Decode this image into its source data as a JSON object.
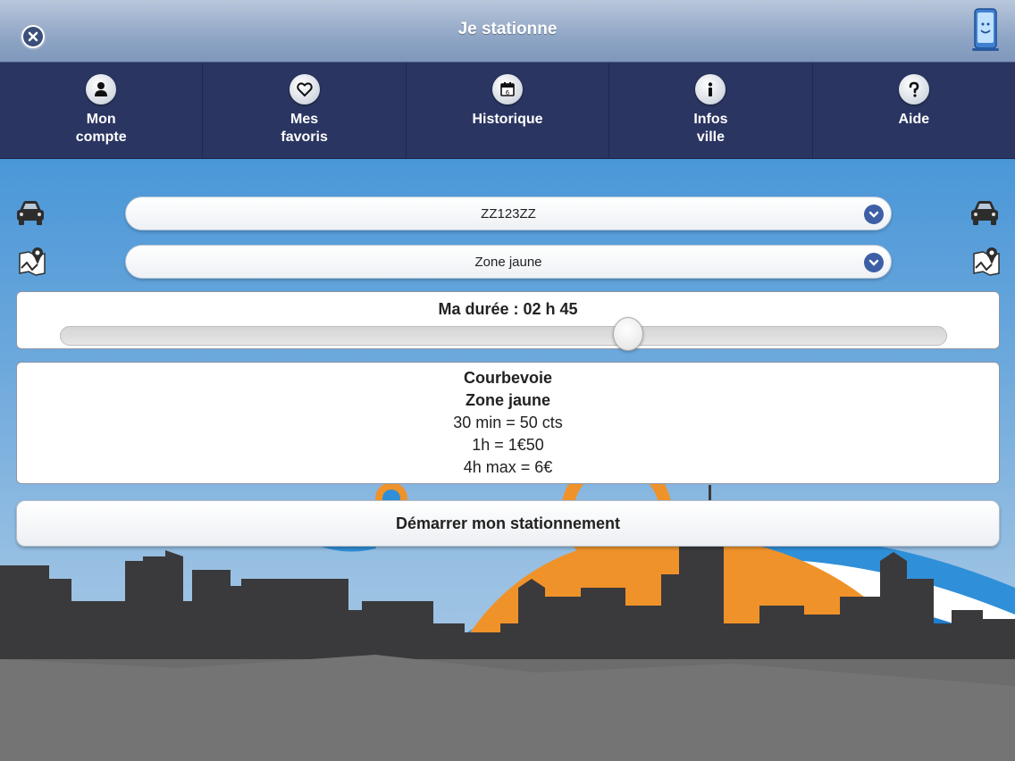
{
  "header": {
    "title": "Je stationne",
    "close_icon": "close-icon",
    "device_icon": "phone-icon"
  },
  "nav": {
    "items": [
      {
        "label_line1": "Mon",
        "label_line2": "compte",
        "icon": "user-icon"
      },
      {
        "label_line1": "Mes",
        "label_line2": "favoris",
        "icon": "heart-icon"
      },
      {
        "label_line1": "Historique",
        "label_line2": "",
        "icon": "calendar-icon"
      },
      {
        "label_line1": "Infos",
        "label_line2": "ville",
        "icon": "info-icon"
      },
      {
        "label_line1": "Aide",
        "label_line2": "",
        "icon": "help-icon"
      }
    ]
  },
  "vehicle_select": {
    "value": "ZZ123ZZ",
    "icon": "car-icon"
  },
  "zone_select": {
    "value": "Zone jaune",
    "icon": "map-pin-icon"
  },
  "duration": {
    "label": "Ma durée : 02 h 45",
    "slider_fraction": 0.64
  },
  "info": {
    "city": "Courbevoie",
    "zone": "Zone jaune",
    "rate_1": "30 min = 50 cts",
    "rate_2": "1h = 1€50",
    "rate_3": "4h max = 6€"
  },
  "start_button": {
    "label": "Démarrer mon stationnement"
  },
  "colors": {
    "nav_bg": "#2a3561",
    "accent": "#3d5fa5",
    "city_orange": "#f0922a",
    "skyline": "#3a3a3c"
  }
}
